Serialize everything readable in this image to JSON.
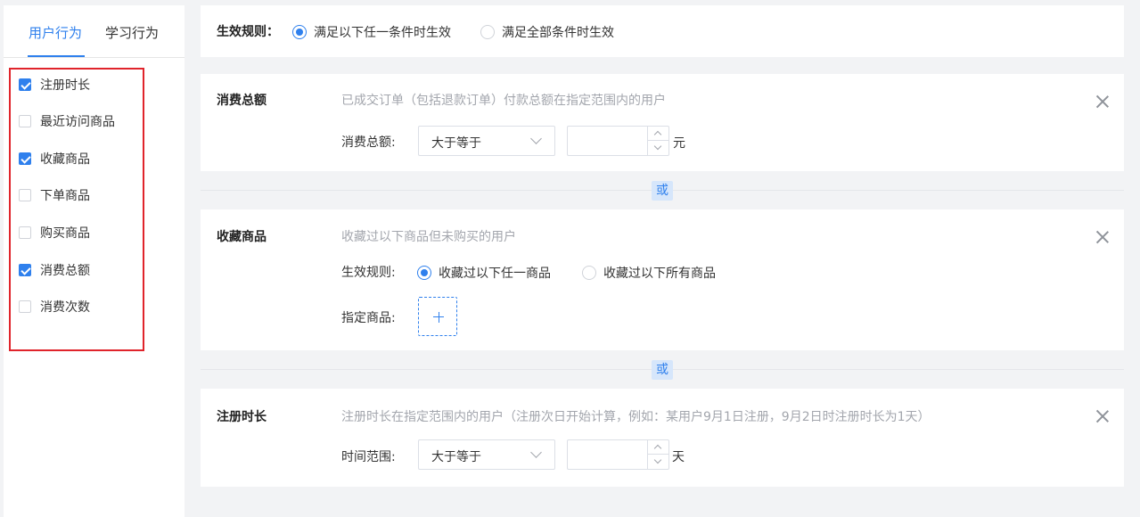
{
  "tabs": [
    {
      "label": "用户行为",
      "active": true
    },
    {
      "label": "学习行为",
      "active": false
    }
  ],
  "conditions": [
    {
      "label": "注册时长",
      "checked": true
    },
    {
      "label": "最近访问商品",
      "checked": false
    },
    {
      "label": "收藏商品",
      "checked": true
    },
    {
      "label": "下单商品",
      "checked": false
    },
    {
      "label": "购买商品",
      "checked": false
    },
    {
      "label": "消费总额",
      "checked": true
    },
    {
      "label": "消费次数",
      "checked": false
    }
  ],
  "rule": {
    "label": "生效规则：",
    "options": [
      {
        "label": "满足以下任一条件时生效",
        "selected": true
      },
      {
        "label": "满足全部条件时生效",
        "selected": false
      }
    ]
  },
  "or_label": "或",
  "consumption_total": {
    "title": "消费总额",
    "description": "已成交订单（包括退款订单）付款总额在指定范围内的用户",
    "field_label": "消费总额:",
    "operator": "大于等于",
    "value": "",
    "unit": "元"
  },
  "favorite_goods": {
    "title": "收藏商品",
    "description": "收藏过以下商品但未购买的用户",
    "rule_label": "生效规则:",
    "options": [
      {
        "label": "收藏过以下任一商品",
        "selected": true
      },
      {
        "label": "收藏过以下所有商品",
        "selected": false
      }
    ],
    "goods_label": "指定商品:"
  },
  "register_duration": {
    "title": "注册时长",
    "description": "注册时长在指定范围内的用户（注册次日开始计算，例如：某用户9月1日注册，9月2日时注册时长为1天）",
    "field_label": "时间范围:",
    "operator": "大于等于",
    "value": "",
    "unit": "天"
  },
  "colors": {
    "accent": "#2f80ed",
    "highlight_border": "#e0242b",
    "background": "#f2f3f5",
    "muted_text": "#a3a6ad"
  },
  "icons": {
    "close": "close-icon",
    "dropdown": "chevron-down-icon",
    "add": "plus-icon",
    "check": "check-icon"
  }
}
